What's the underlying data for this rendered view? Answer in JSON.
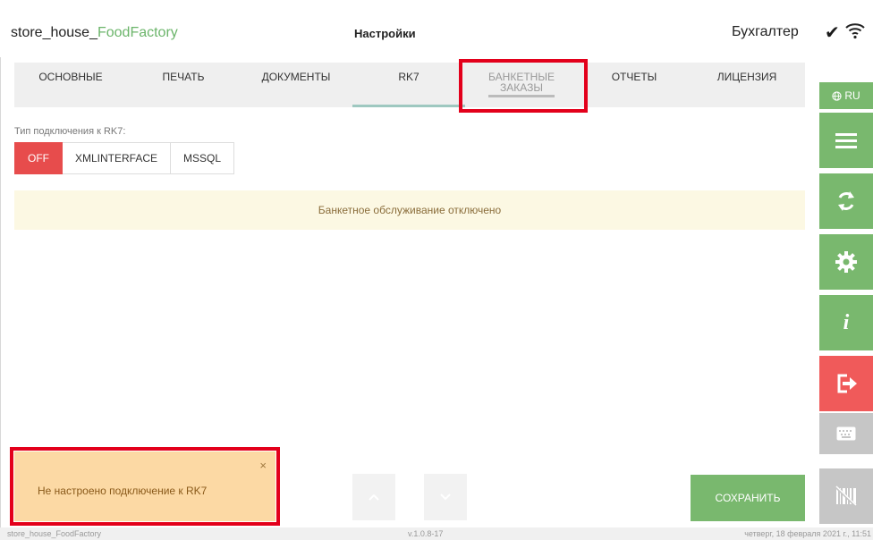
{
  "header": {
    "app_name_prefix": "store_house_",
    "app_name_brand": "FoodFactory",
    "page_title": "Настройки",
    "user_name": "Бухгалтер",
    "check_glyph": "✔"
  },
  "tabs": [
    {
      "label": "ОСНОВНЫЕ"
    },
    {
      "label": "ПЕЧАТЬ"
    },
    {
      "label": "ДОКУМЕНТЫ"
    },
    {
      "label": "RK7",
      "active": true
    },
    {
      "label_line1": "БАНКЕТНЫЕ",
      "label_line2": "ЗАКАЗЫ",
      "disabled": true
    },
    {
      "label": "ОТЧЕТЫ"
    },
    {
      "label": "ЛИЦЕНЗИЯ"
    }
  ],
  "sidebar": {
    "lang_label": "RU",
    "buttons": [
      {
        "icon": "menu-icon"
      },
      {
        "icon": "sync-icon"
      },
      {
        "icon": "gear-icon"
      },
      {
        "icon": "info-icon",
        "glyph": "i"
      },
      {
        "icon": "logout-icon"
      },
      {
        "icon": "keyboard-icon"
      },
      {
        "icon": "barcode-off-icon"
      }
    ]
  },
  "connection": {
    "label": "Тип подключения к RK7:",
    "options": [
      "OFF",
      "XMLINTERFACE",
      "MSSQL"
    ],
    "selected": "OFF"
  },
  "banner": {
    "text": "Банкетное обслуживание отключено"
  },
  "toast": {
    "text": "Не настроено подключение к RK7",
    "close_glyph": "×"
  },
  "actions": {
    "save_label": "СОХРАНИТЬ"
  },
  "footer": {
    "app_name": "store_house_FoodFactory",
    "version": "v.1.0.8-17",
    "datetime": "четверг, 18 февраля 2021 г., 11:51"
  },
  "colors": {
    "accent_green": "#79b86e",
    "danger_red": "#f05a5a",
    "highlight_red": "#e3001b"
  }
}
